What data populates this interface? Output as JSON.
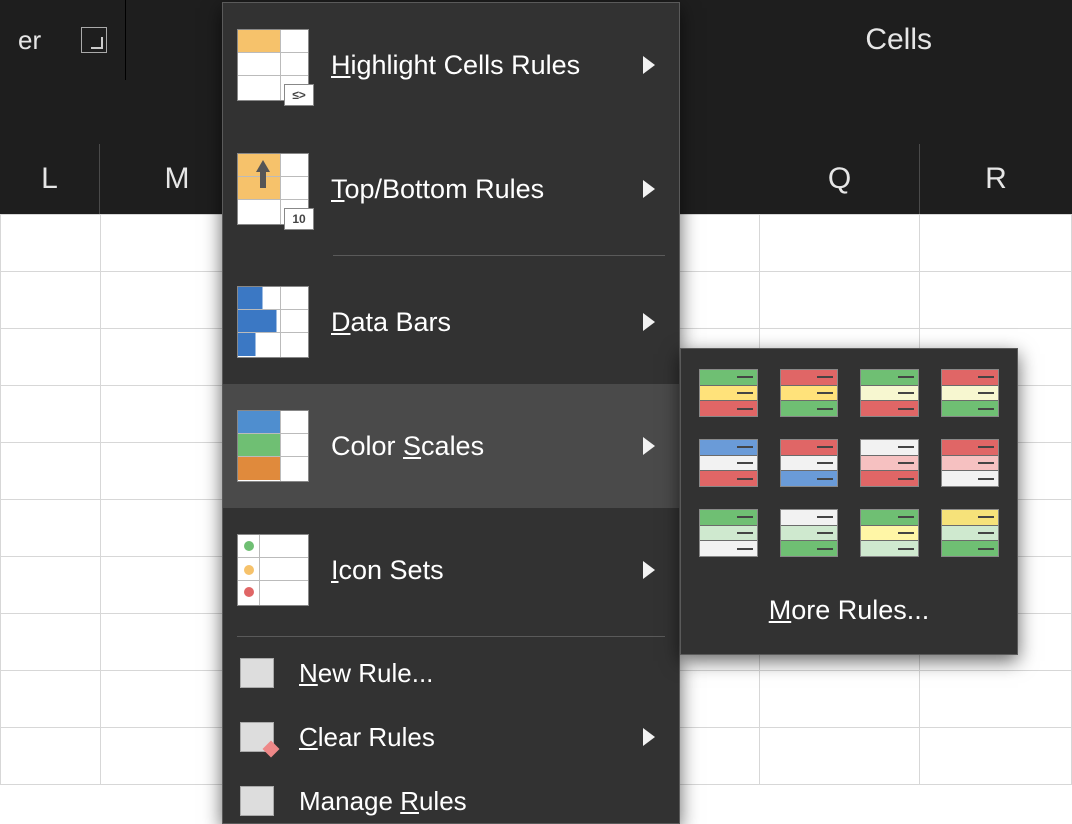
{
  "ribbon": {
    "group_left_label_fragment": "er",
    "cells_label": "Cells"
  },
  "columns": {
    "L": "L",
    "M": "M",
    "Q": "Q",
    "R": "R"
  },
  "menu": {
    "highlight": {
      "pre": "",
      "u": "H",
      "post": "ighlight Cells Rules"
    },
    "topbottom": {
      "pre": "",
      "u": "T",
      "post": "op/Bottom Rules"
    },
    "databars": {
      "pre": "",
      "u": "D",
      "post": "ata Bars"
    },
    "colorscales": {
      "pre": "Color ",
      "u": "S",
      "post": "cales"
    },
    "iconsets": {
      "pre": "",
      "u": "I",
      "post": "con Sets"
    },
    "newrule": {
      "pre": "",
      "u": "N",
      "post": "ew Rule..."
    },
    "clearrules": {
      "pre": "",
      "u": "C",
      "post": "lear Rules"
    },
    "managerules": {
      "pre": "Manage ",
      "u": "R",
      "post": "ules"
    }
  },
  "submenu": {
    "colorscales": [
      [
        "#6fbf73",
        "#ffe27a",
        "#e06666"
      ],
      [
        "#e06666",
        "#ffe27a",
        "#6fbf73"
      ],
      [
        "#6fbf73",
        "#f7f7d0",
        "#e06666"
      ],
      [
        "#e06666",
        "#f7f7d0",
        "#6fbf73"
      ],
      [
        "#6a9bd8",
        "#f2f2f2",
        "#e06666"
      ],
      [
        "#e06666",
        "#f2f2f2",
        "#6a9bd8"
      ],
      [
        "#f2f2f2",
        "#f6c1c1",
        "#e06666"
      ],
      [
        "#e06666",
        "#f6c1c1",
        "#f2f2f2"
      ],
      [
        "#6fbf73",
        "#cfe9cf",
        "#f2f2f2"
      ],
      [
        "#f2f2f2",
        "#cfe9cf",
        "#6fbf73"
      ],
      [
        "#6fbf73",
        "#fff6a6",
        "#cfe9cf"
      ],
      [
        "#f6e27a",
        "#cfe9cf",
        "#6fbf73"
      ]
    ],
    "more_rules": {
      "pre": "",
      "u": "M",
      "post": "ore Rules..."
    }
  }
}
